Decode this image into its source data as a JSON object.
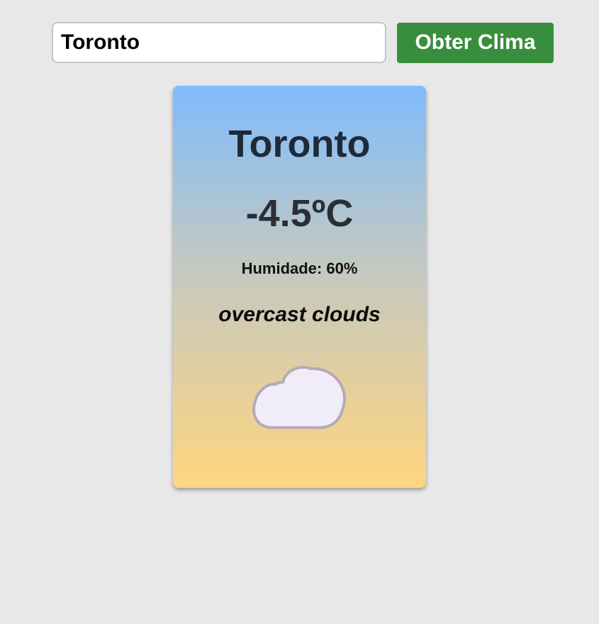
{
  "search": {
    "value": "Toronto",
    "button_label": "Obter Clima"
  },
  "weather": {
    "city": "Toronto",
    "temperature": "-4.5ºC",
    "humidity_label": "Humidade:",
    "humidity_value": "60%",
    "description": "overcast clouds",
    "icon": "cloud-icon"
  },
  "colors": {
    "background": "#e8e8e8",
    "button": "#388e3c",
    "card_gradient_top": "#7fbcfd",
    "card_gradient_bottom": "#ffd57f",
    "cloud_fill": "#f1edf8",
    "cloud_stroke": "#b5aab9"
  }
}
